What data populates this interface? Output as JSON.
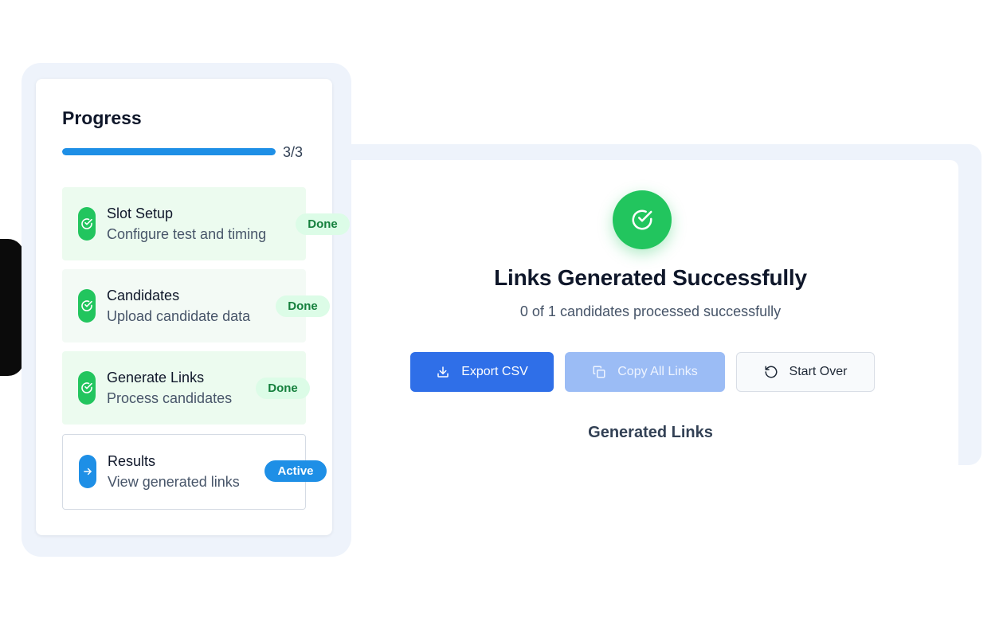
{
  "sidebar": {
    "title": "Progress",
    "progress": {
      "current": 3,
      "total": 3,
      "label": "3/3",
      "fraction": 1.0
    },
    "steps": [
      {
        "name": "Slot Setup",
        "description": "Configure test and timing",
        "status": "Done",
        "icon": "check-circle-icon"
      },
      {
        "name": "Candidates",
        "description": "Upload candidate data",
        "status": "Done",
        "icon": "check-circle-icon"
      },
      {
        "name": "Generate Links",
        "description": "Process candidates",
        "status": "Done",
        "icon": "check-circle-icon"
      },
      {
        "name": "Results",
        "description": "View generated links",
        "status": "Active",
        "icon": "arrow-right-icon"
      }
    ]
  },
  "main": {
    "success_icon": "check-circle-icon",
    "title": "Links Generated Successfully",
    "subtitle": "0 of 1 candidates processed successfully",
    "buttons": {
      "export": {
        "label": "Export CSV",
        "icon": "download-icon"
      },
      "copy": {
        "label": "Copy All Links",
        "icon": "copy-icon"
      },
      "start_over": {
        "label": "Start Over",
        "icon": "rotate-ccw-icon"
      }
    },
    "section_heading": "Generated Links"
  },
  "colors": {
    "primary": "#2f6fe8",
    "success": "#22c55e",
    "active": "#1e8fe6"
  }
}
